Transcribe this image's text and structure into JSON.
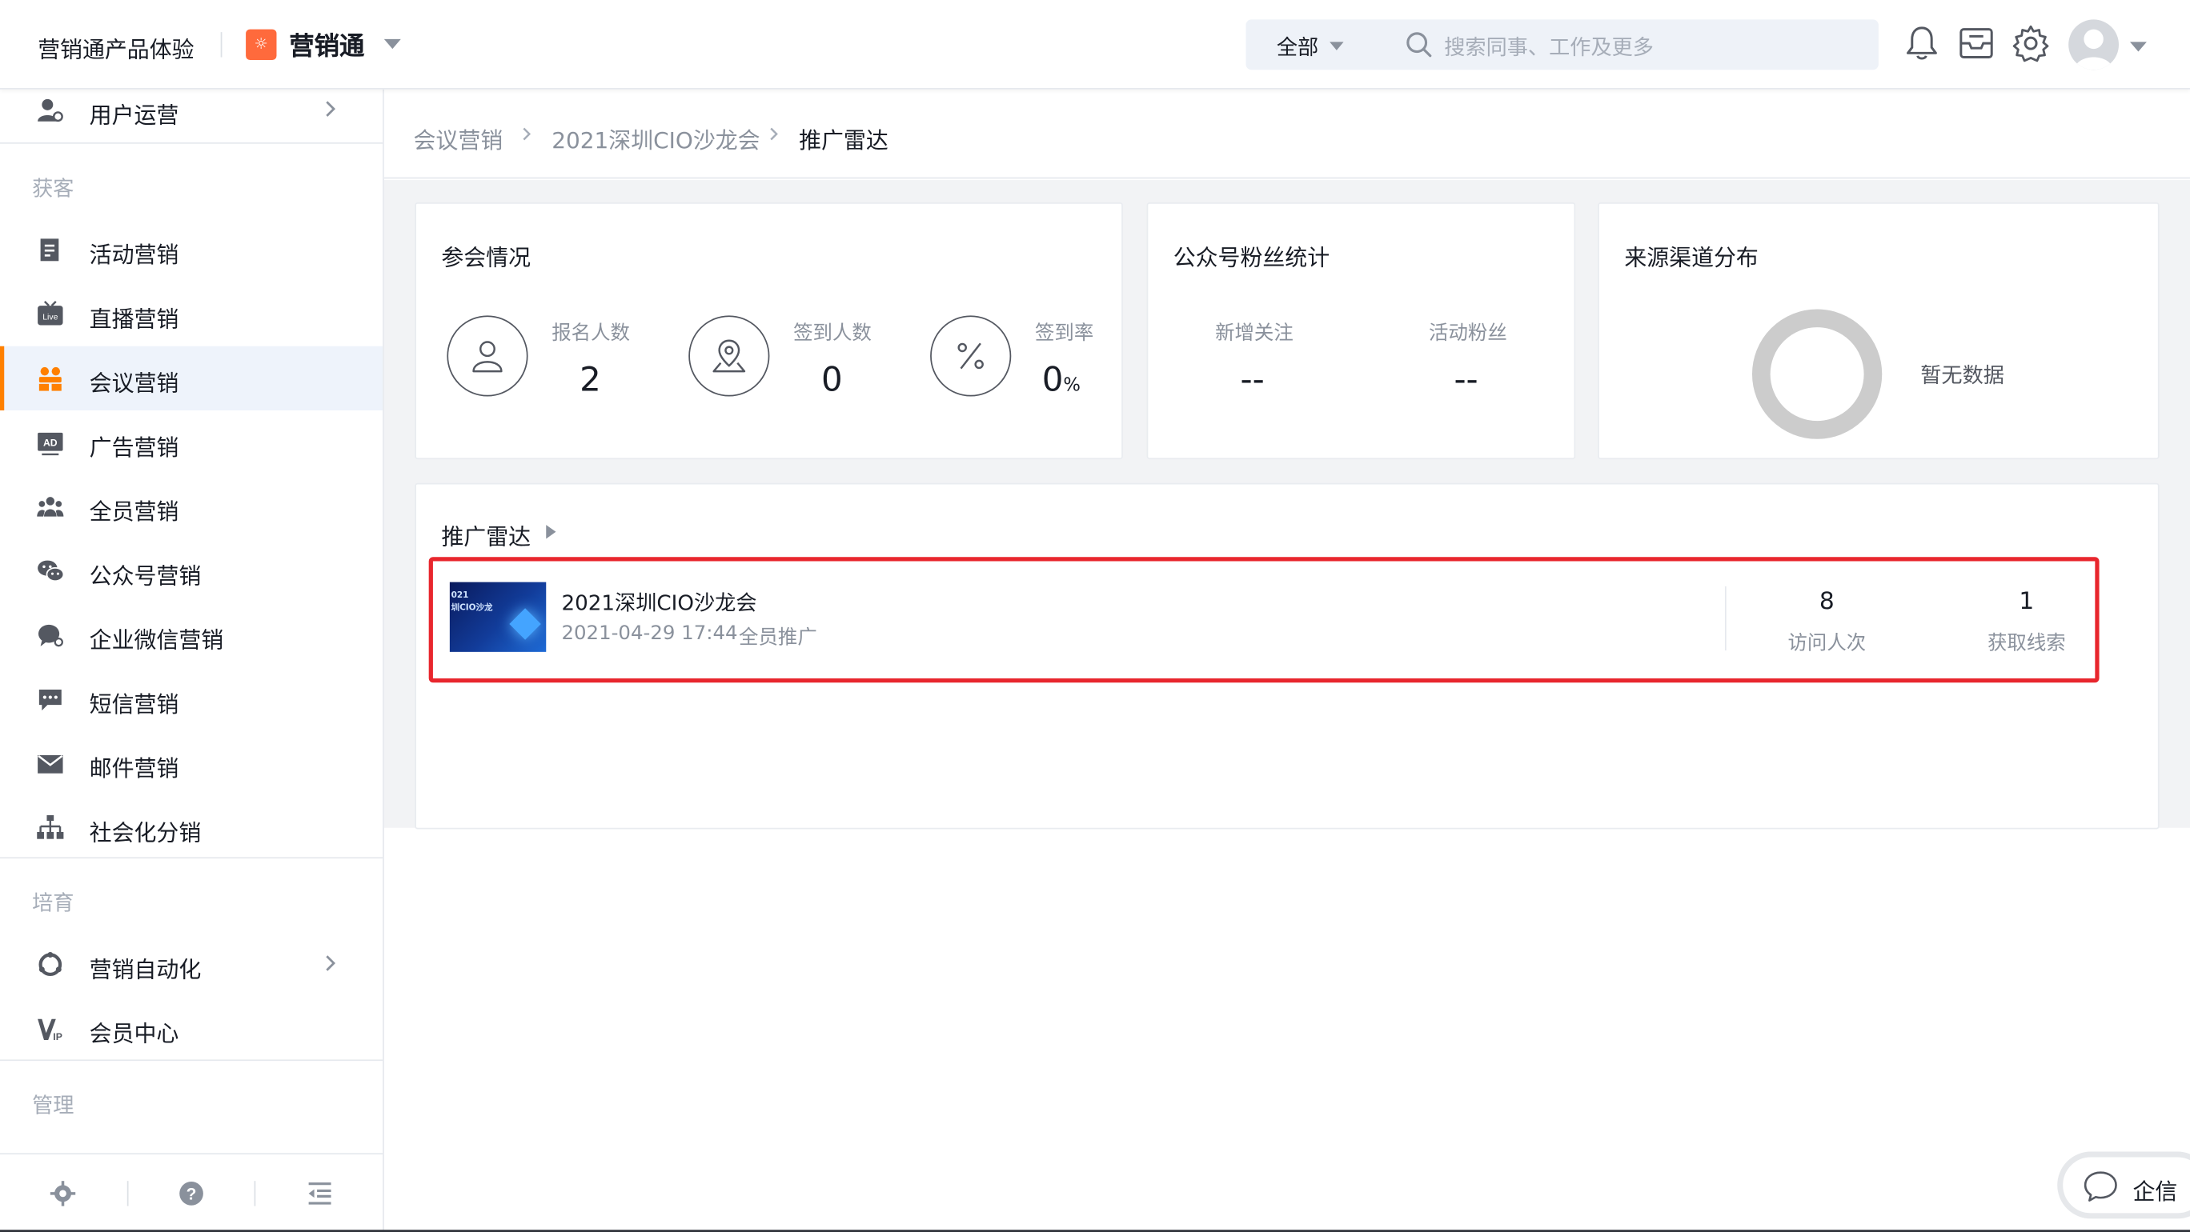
{
  "header": {
    "app_name": "营销通产品体验",
    "brand_name": "营销通",
    "search_scope": "全部",
    "search_placeholder": "搜索同事、工作及更多"
  },
  "sidebar": {
    "top_item": "用户运营",
    "groups": [
      {
        "title": "获客",
        "items": [
          "活动营销",
          "直播营销",
          "会议营销",
          "广告营销",
          "全员营销",
          "公众号营销",
          "企业微信营销",
          "短信营销",
          "邮件营销",
          "社会化分销"
        ]
      },
      {
        "title": "培育",
        "items": [
          "营销自动化",
          "会员中心"
        ]
      },
      {
        "title": "管理",
        "items": []
      }
    ],
    "active_item": "会议营销"
  },
  "breadcrumb": [
    "会议营销",
    "2021深圳CIO沙龙会",
    "推广雷达"
  ],
  "attendance": {
    "title": "参会情况",
    "stats": [
      {
        "label": "报名人数",
        "value": "2",
        "unit": ""
      },
      {
        "label": "签到人数",
        "value": "0",
        "unit": ""
      },
      {
        "label": "签到率",
        "value": "0",
        "unit": "%"
      }
    ]
  },
  "fans": {
    "title": "公众号粉丝统计",
    "stats": [
      {
        "label": "新增关注",
        "value": "--"
      },
      {
        "label": "活动粉丝",
        "value": "--"
      }
    ]
  },
  "channels": {
    "title": "来源渠道分布",
    "empty_text": "暂无数据"
  },
  "radar": {
    "title": "推广雷达",
    "items": [
      {
        "thumb_text_line1": "021",
        "thumb_text_line2": "圳CIO沙龙",
        "name": "2021深圳CIO沙龙会",
        "datetime": "2021-04-29 17:44",
        "tag": "全员推广",
        "visits": "8",
        "visits_label": "访问人次",
        "leads": "1",
        "leads_label": "获取线索"
      }
    ]
  },
  "chat_widget": {
    "label": "企信"
  },
  "colors": {
    "accent_orange": "#ff8000",
    "brand_icon": "#ff6a3c",
    "highlight_red": "#e8262d",
    "active_bg": "#eef3fb"
  }
}
